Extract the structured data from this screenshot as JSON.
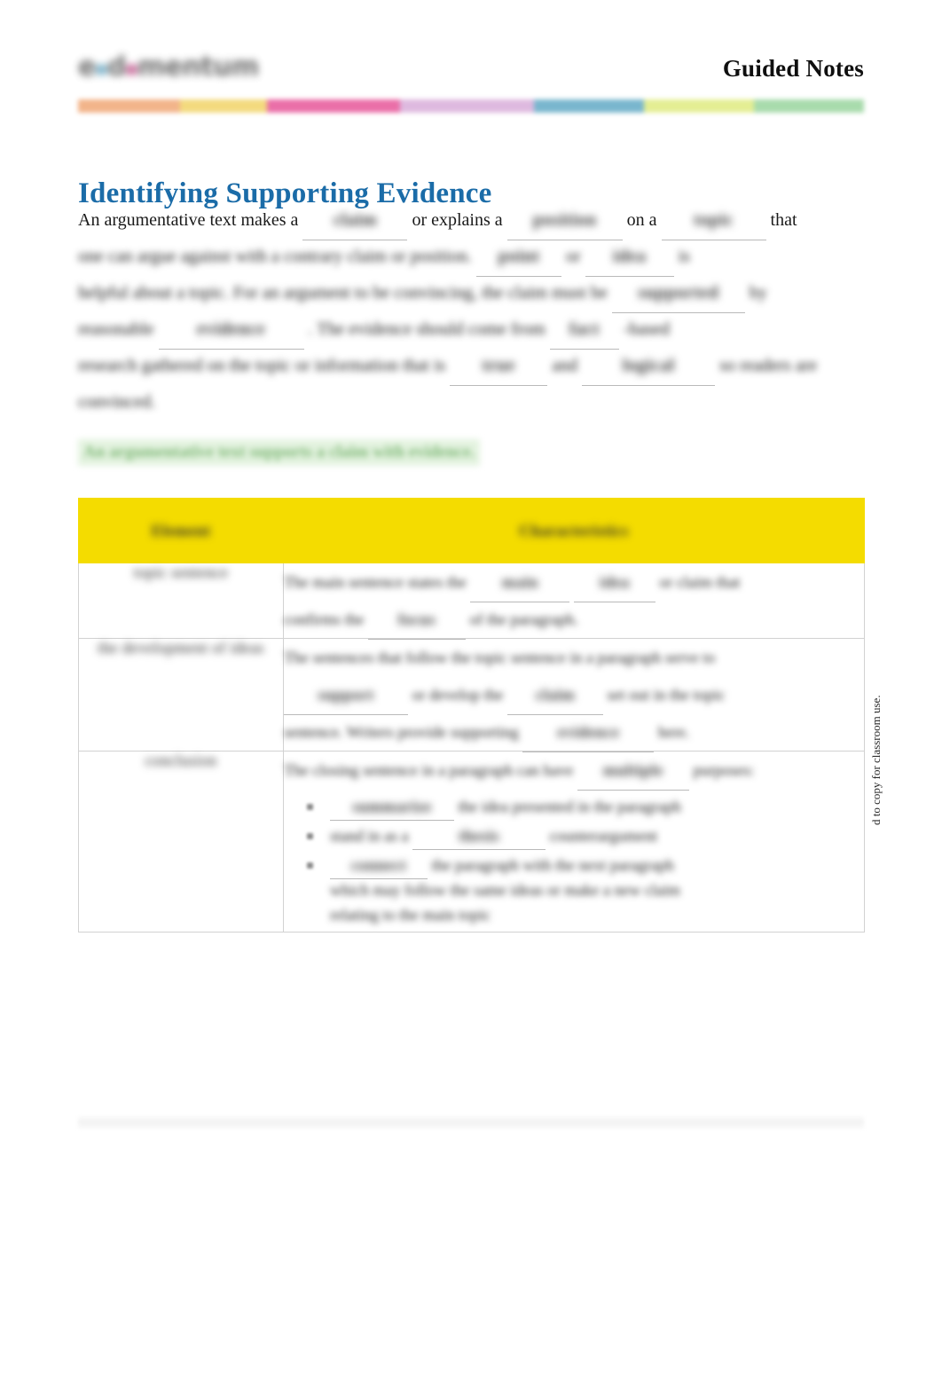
{
  "header": {
    "logo_prefix": "e",
    "logo_mid": "mentum",
    "logo_tail": "",
    "logo_name": "edmentum-logo",
    "doc_kind": "Guided Notes"
  },
  "colorbar": {
    "segments": [
      {
        "name": "orange",
        "color": "#F2B48A",
        "width": 13
      },
      {
        "name": "yellow",
        "color": "#F3DA7E",
        "width": 11
      },
      {
        "name": "pink",
        "color": "#EA6FA8",
        "width": 17
      },
      {
        "name": "lavender",
        "color": "#DEB9DF",
        "width": 17
      },
      {
        "name": "blue",
        "color": "#79B6CE",
        "width": 14
      },
      {
        "name": "yellow-green",
        "color": "#E4EE93",
        "width": 14
      },
      {
        "name": "green",
        "color": "#A8DBAC",
        "width": 14
      }
    ]
  },
  "title": "Identifying Supporting Evidence",
  "intro": {
    "line1": {
      "a": "An argumentative text makes a",
      "blank1": "claim",
      "b": "or explains a",
      "blank2": "position",
      "c": "on a",
      "blank3": "topic",
      "d": "that"
    },
    "line2": {
      "a": "one can argue against with a contrary claim or position.",
      "blank1": "point",
      "b": "or",
      "blank2": "idea",
      "c": "is"
    },
    "line3": {
      "a": "helpful about a topic. For an argument to be convincing, the claim must be",
      "blank1": "supported",
      "b": "by"
    },
    "line4": {
      "a": "reasonable",
      "blank1": "evidence",
      "b": ". The evidence should come from",
      "blank2": "fact",
      "c": "-based"
    },
    "line5": {
      "a": "research gathered on the topic or information that is",
      "blank1": "true",
      "b": "and",
      "blank2": "logical",
      "c": "so readers are"
    },
    "line6": {
      "a": "convinced."
    }
  },
  "green_note": "An argumentative text supports a claim with evidence.",
  "table": {
    "headers": [
      "Element",
      "Characteristics"
    ],
    "rows": [
      {
        "term": "topic sentence",
        "lines": [
          {
            "a": "The main sentence states the",
            "blank1": "main",
            "b": "idea",
            "c": "or claim that"
          },
          {
            "a": "confirms the",
            "blank1": "focus",
            "b": "of the paragraph."
          }
        ]
      },
      {
        "term": "the development of ideas",
        "lines": [
          {
            "a": "The sentences that follow the topic sentence in a paragraph serve to"
          },
          {
            "a": "",
            "blank1": "support",
            "b": "or develop the",
            "blank2": "claim",
            "c": "set out in the topic"
          },
          {
            "a": "sentence. Writers provide supporting",
            "blank1": "evidence",
            "b": "here."
          }
        ]
      },
      {
        "term": "conclusion",
        "lines": [
          {
            "a": "The closing sentence in a paragraph can have",
            "blank1": "multiple",
            "b": "purposes:"
          }
        ],
        "bullets": [
          {
            "blank1": "summarize",
            "a": "the idea presented in the paragraph"
          },
          {
            "a": "stand in as a",
            "blank1": "thesis",
            "b": "counterargument"
          },
          {
            "blank1": "connect",
            "a": "the paragraph with the next paragraph",
            "sub1": "which may follow the same ideas or make a new claim",
            "sub2": "relating to the main topic"
          }
        ]
      }
    ]
  },
  "side_note": "d to copy for classroom use.",
  "bullet_glyph": "bullet-square-icon"
}
